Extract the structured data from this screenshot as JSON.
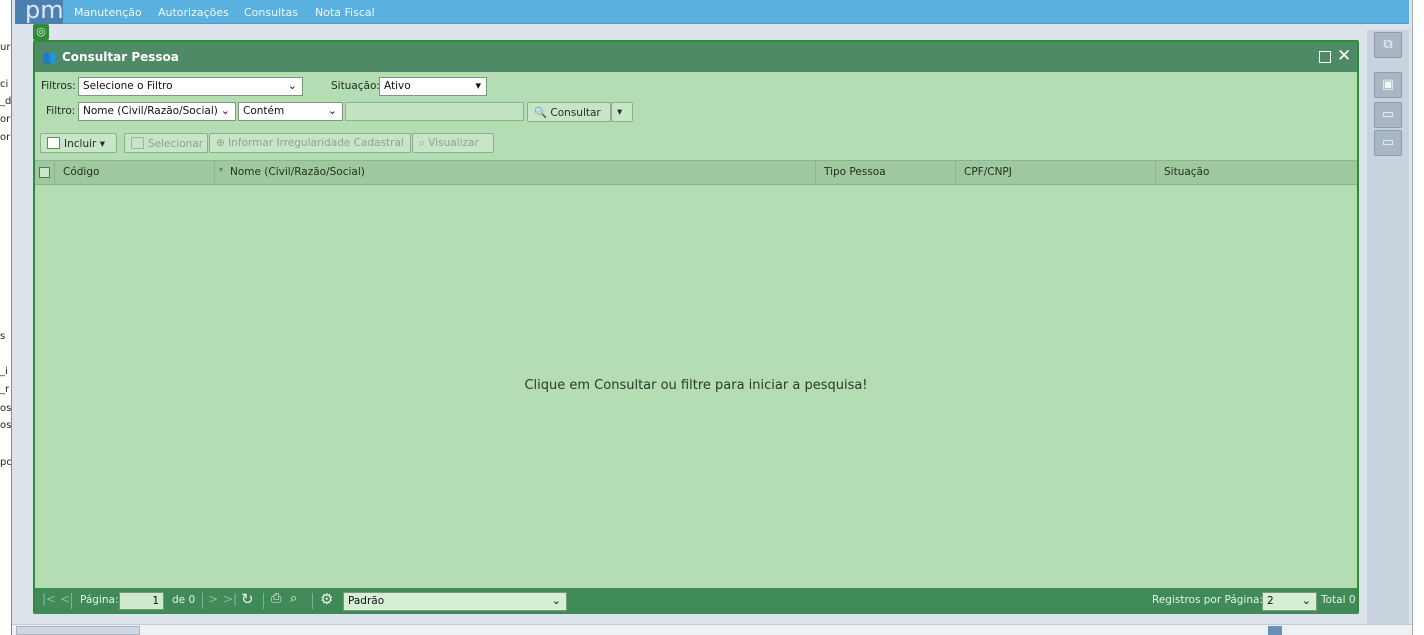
{
  "left_fragments": [
    "ur",
    "ci",
    "_d",
    "or",
    "or",
    "s",
    "_i",
    "_r",
    "os",
    "os",
    "pc"
  ],
  "logo": {
    "text": "pm"
  },
  "menu": {
    "items": [
      "Manutenção",
      "Autorizações",
      "Consultas",
      "Nota Fiscal"
    ]
  },
  "window": {
    "title": "Consultar Pessoa",
    "filters": {
      "filtros_label": "Filtros:",
      "filtros_value": "Selecione o Filtro",
      "situacao_label": "Situação:",
      "situacao_value": "Ativo",
      "filtro_label": "Filtro:",
      "filtro_field_value": "Nome (Civil/Razão/Social)",
      "filtro_operator_value": "Contém",
      "search_value": "",
      "consultar_label": "Consultar"
    },
    "toolbar": {
      "incluir": "Incluir",
      "selecionar": "Selecionar",
      "informar": "Informar Irregularidade Cadastral",
      "visualizar": "Visualizar"
    },
    "grid": {
      "columns": [
        "Código",
        "Nome (Civil/Razão/Social)",
        "Tipo Pessoa",
        "CPF/CNPJ",
        "Situação"
      ],
      "empty_message": "Clique em Consultar ou filtre para iniciar a pesquisa!"
    },
    "pager": {
      "pagina_label": "Página:",
      "page_value": "1",
      "de_label": "de 0",
      "layout_value": "Padrão",
      "registros_label": "Registros por Página:",
      "registros_value": "2",
      "total_label": "Total 0"
    }
  },
  "colors": {
    "window_bg": "#b4ddb4",
    "titlebar": "#4e8a66",
    "menubar": "#5ab1df",
    "border": "#2f8a3a"
  }
}
